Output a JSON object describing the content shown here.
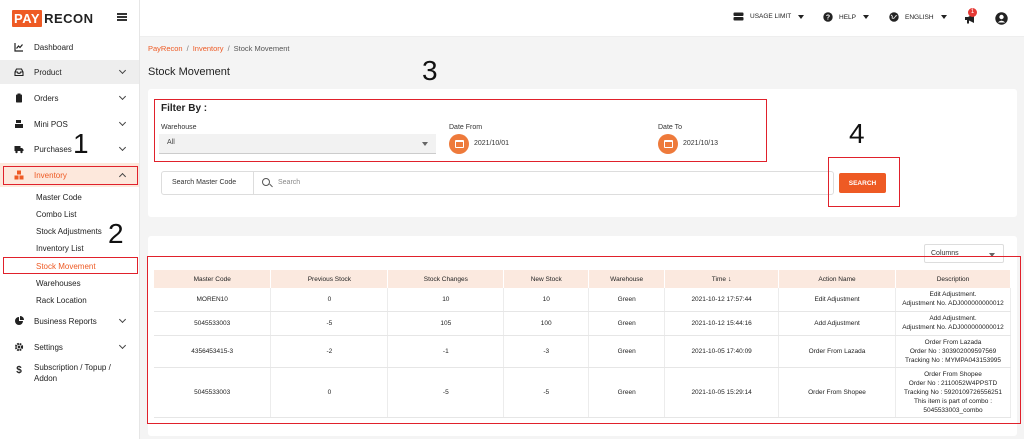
{
  "brand": {
    "pay": "PAY",
    "recon": "RECON"
  },
  "topbar": {
    "usage_limit": "USAGE LIMIT",
    "help": "HELP",
    "language": "ENGLISH",
    "notification_count": "1"
  },
  "sidebar": {
    "items": [
      {
        "label": "Dashboard",
        "icon": "chart-line-icon"
      },
      {
        "label": "Product",
        "icon": "inbox-icon"
      },
      {
        "label": "Orders",
        "icon": "clipboard-icon"
      },
      {
        "label": "Mini POS",
        "icon": "cash-register-icon"
      },
      {
        "label": "Purchases",
        "icon": "truck-icon"
      },
      {
        "label": "Inventory",
        "icon": "boxes-icon"
      },
      {
        "label": "Business Reports",
        "icon": "pie-chart-icon"
      },
      {
        "label": "Settings",
        "icon": "gear-icon"
      },
      {
        "label": "Subscription / Topup / Addon",
        "icon": "dollar-icon"
      }
    ],
    "inventory_sub": [
      "Master Code",
      "Combo List",
      "Stock Adjustments",
      "Inventory List",
      "Stock Movement",
      "Warehouses",
      "Rack Location"
    ],
    "subscription_line1": "Subscription / Topup /",
    "subscription_line2": "Addon"
  },
  "breadcrumb": {
    "root": "PayRecon",
    "parent": "Inventory",
    "current": "Stock Movement"
  },
  "page_title": "Stock Movement",
  "filter": {
    "heading": "Filter By :",
    "warehouse_label": "Warehouse",
    "warehouse_value": "All",
    "date_from_label": "Date From",
    "date_from_value": "2021/10/01",
    "date_to_label": "Date To",
    "date_to_value": "2021/10/13",
    "search_label": "Search Master Code",
    "search_placeholder": "Search",
    "search_button": "SEARCH"
  },
  "columns_button": "Columns",
  "table": {
    "headers": [
      "Master Code",
      "Previous Stock",
      "Stock Changes",
      "New Stock",
      "Warehouse",
      "Time",
      "Action Name",
      "Description"
    ],
    "sort_indicator": "↓",
    "rows": [
      {
        "master_code": "MOREN10",
        "previous": "0",
        "change": "10",
        "new": "10",
        "warehouse": "Green",
        "time": "2021-10-12 17:57:44",
        "action": "Edit Adjustment",
        "desc": [
          "Edit Adjustment.",
          "Adjustment No. ADJ000000000012"
        ]
      },
      {
        "master_code": "5045533003",
        "previous": "-5",
        "change": "105",
        "new": "100",
        "warehouse": "Green",
        "time": "2021-10-12 15:44:16",
        "action": "Add Adjustment",
        "desc": [
          "Add Adjustment.",
          "Adjustment No. ADJ000000000012"
        ]
      },
      {
        "master_code": "4356453415-3",
        "previous": "-2",
        "change": "-1",
        "new": "-3",
        "warehouse": "Green",
        "time": "2021-10-05 17:40:09",
        "action": "Order From Lazada",
        "desc": [
          "Order From Lazada",
          "Order No : 303902009597569",
          "Tracking No : MYMPA043153995"
        ]
      },
      {
        "master_code": "5045533003",
        "previous": "0",
        "change": "-5",
        "new": "-5",
        "warehouse": "Green",
        "time": "2021-10-05 15:29:14",
        "action": "Order From Shopee",
        "desc": [
          "Order From Shopee",
          "Order No : 2110052W4PPSTD",
          "Tracking No : 5920109726556251",
          "This item is part of combo :",
          "5045533003_combo"
        ]
      }
    ]
  },
  "annotations": [
    "1",
    "2",
    "3",
    "4"
  ],
  "colors": {
    "accent": "#ee5a24",
    "annotation": "#e0212b",
    "header_bg": "#fbe9df"
  }
}
